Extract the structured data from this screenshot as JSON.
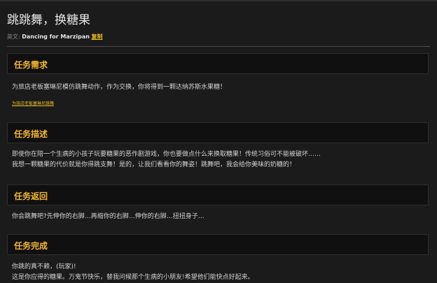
{
  "title": "跳跳舞，换糖果",
  "english": {
    "label": "英文:",
    "name": "Dancing for Marzipan",
    "copy_label": "复制"
  },
  "sections": [
    {
      "heading": "任务需求",
      "lines": [
        "为旅店老板塞琳尼模仿跳舞动作，作为交换，你将得到一颗达纳苏斯水果糖！"
      ],
      "link": "为旅店老板塞琳尼跳舞"
    },
    {
      "heading": "任务描述",
      "lines": [
        "即使你在陪一个生病的小孩子玩要糖果的恶作剧游戏，你也要做点什么来换取糖果！传统习俗可不能被破坏……",
        "我想一颗糖果的代价就是你得跳支舞！是的，让我们看看你的舞姿！跳舞吧，我会给你美味的奶糖的！"
      ]
    },
    {
      "heading": "任务返回",
      "lines": [
        "你会跳舞吧?先伸你的右脚…再缩你的右脚…伸你的右脚…扭扭身子…"
      ]
    },
    {
      "heading": "任务完成",
      "lines": [
        "你跳的真不赖，(玩家)!",
        "这是你应得的糖果。万鬼节快乐，替我问候那个生病的小朋友!希望他们能快点好起来。"
      ]
    }
  ]
}
